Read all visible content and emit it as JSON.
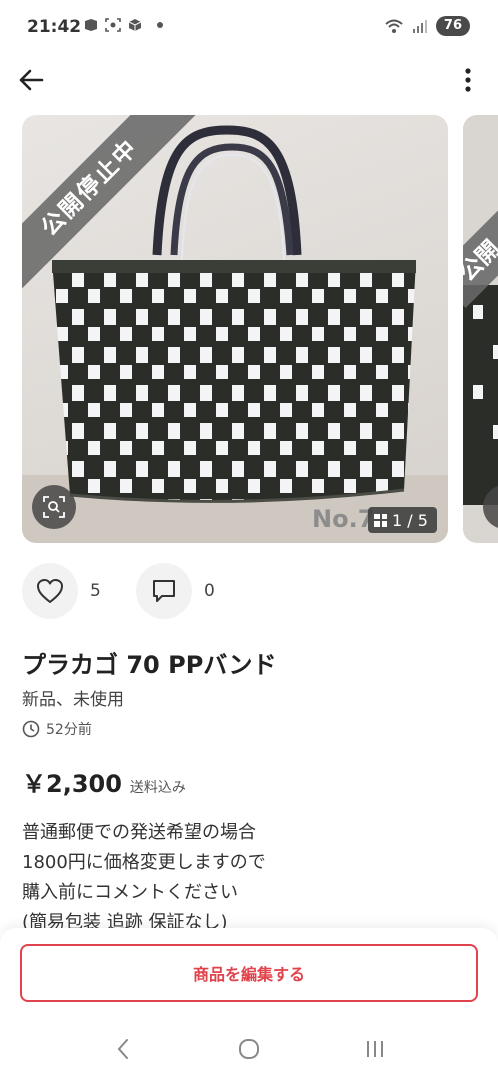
{
  "status_bar": {
    "time": "21:42",
    "battery": "76"
  },
  "nav": {
    "back_icon": "arrow-left-icon",
    "more_icon": "more-vertical-icon"
  },
  "gallery": {
    "status_ribbon": "公開停止中",
    "ribbon_next_partial": "公開",
    "photo_caption": "No.7",
    "page_counter": "1 / 5",
    "zoom_icon": "zoom-scan-icon"
  },
  "actions": {
    "like_count": "5",
    "comment_count": "0"
  },
  "item": {
    "title": "プラカゴ 70 PPバンド",
    "condition": "新品、未使用",
    "posted": "52分前",
    "price": "￥2,300",
    "shipping": "送料込み",
    "description": [
      "普通郵便での発送希望の場合",
      "1800円に価格変更しますので",
      "購入前にコメントください",
      "(簡易包装 追跡 保証なし)"
    ]
  },
  "bottom": {
    "edit_button": "商品を編集する"
  },
  "colors": {
    "accent": "#e0434b",
    "ribbon": "#696969"
  }
}
